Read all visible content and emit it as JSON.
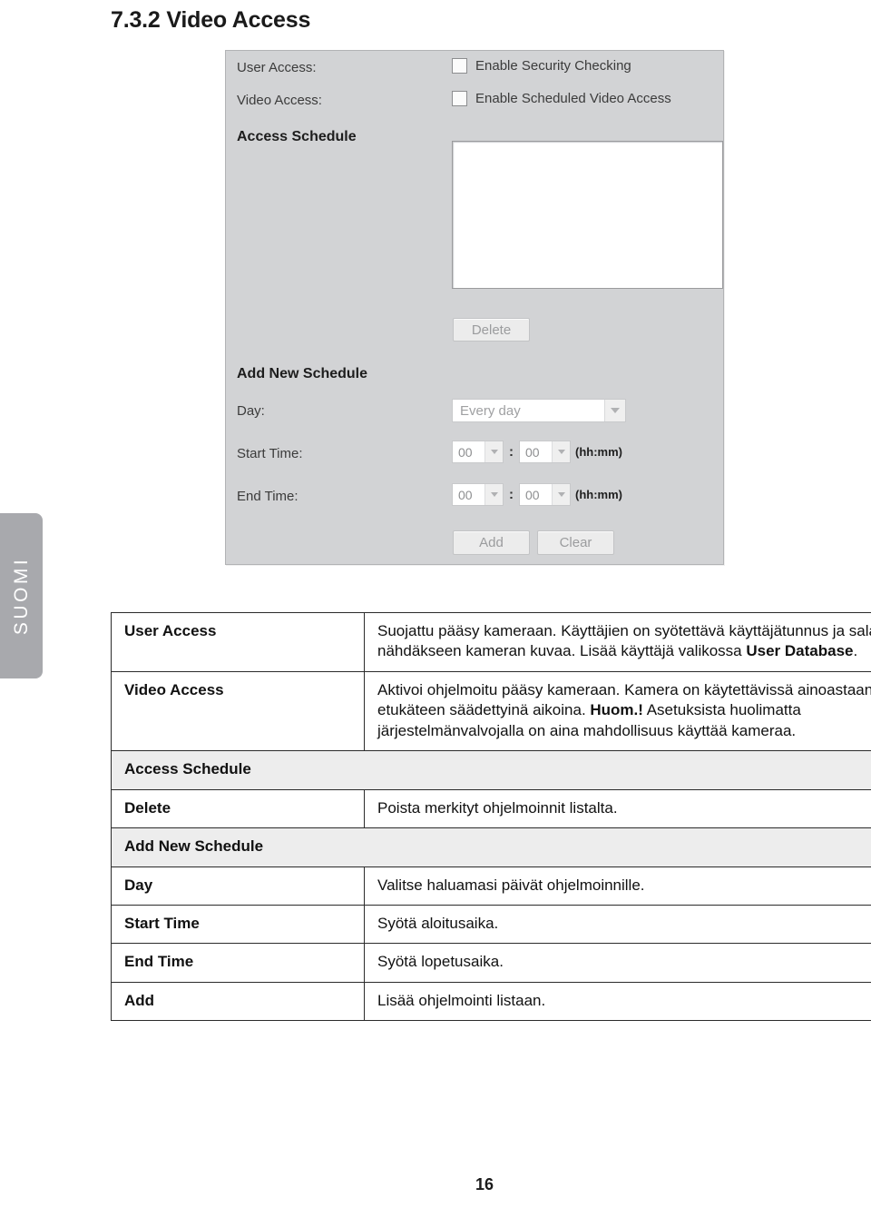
{
  "document": {
    "heading": "7.3.2 Video Access",
    "page_number": "16",
    "language_tab": "SUOMI"
  },
  "screenshot": {
    "user_access_label": "User Access:",
    "video_access_label": "Video Access:",
    "enable_security_checking": "Enable Security Checking",
    "enable_scheduled_video_access": "Enable Scheduled Video Access",
    "access_schedule_heading": "Access Schedule",
    "delete_button": "Delete",
    "add_new_schedule_heading": "Add New Schedule",
    "day_label": "Day:",
    "day_value": "Every day",
    "start_time_label": "Start Time:",
    "end_time_label": "End Time:",
    "start_hour": "00",
    "start_minute": "00",
    "end_hour": "00",
    "end_minute": "00",
    "time_separator": ":",
    "time_format_hint": "(hh:mm)",
    "add_button": "Add",
    "clear_button": "Clear",
    "colors": {
      "panel_background": "#d2d3d5",
      "listbox_background": "#ffffff",
      "button_face": "#ececec",
      "disabled_text": "#9b9c9e"
    }
  },
  "reference_table": {
    "rows": [
      {
        "type": "entry",
        "term": "User Access",
        "desc_parts": [
          {
            "text": "Suojattu pääsy kameraan. Käyttäjien on syötettävä käyttäjätunnus ja salasana nähdäkseen kameran kuvaa. Lisää käyttäjä valikossa ",
            "bold": false
          },
          {
            "text": "User Database",
            "bold": true
          },
          {
            "text": ".",
            "bold": false
          }
        ]
      },
      {
        "type": "entry",
        "term": "Video Access",
        "desc_parts": [
          {
            "text": "Aktivoi ohjelmoitu pääsy kameraan. Kamera on käytettävissä ainoastaan etukäteen säädettyinä aikoina. ",
            "bold": false
          },
          {
            "text": "Huom.!",
            "bold": true
          },
          {
            "text": " Asetuksista huolimatta järjestelmänvalvojalla on aina mahdollisuus käyttää kameraa.",
            "bold": false
          }
        ]
      },
      {
        "type": "section",
        "term": "Access Schedule"
      },
      {
        "type": "entry",
        "term": "Delete",
        "desc_parts": [
          {
            "text": "Poista merkityt ohjelmoinnit listalta.",
            "bold": false
          }
        ]
      },
      {
        "type": "section",
        "term": "Add New Schedule"
      },
      {
        "type": "entry",
        "term": "Day",
        "desc_parts": [
          {
            "text": "Valitse haluamasi päivät ohjelmoinnille.",
            "bold": false
          }
        ]
      },
      {
        "type": "entry",
        "term": "Start Time",
        "desc_parts": [
          {
            "text": "Syötä aloitusaika.",
            "bold": false
          }
        ]
      },
      {
        "type": "entry",
        "term": "End Time",
        "desc_parts": [
          {
            "text": "Syötä lopetusaika.",
            "bold": false
          }
        ]
      },
      {
        "type": "entry",
        "term": "Add",
        "desc_parts": [
          {
            "text": "Lisää ohjelmointi listaan.",
            "bold": false
          }
        ]
      }
    ]
  }
}
